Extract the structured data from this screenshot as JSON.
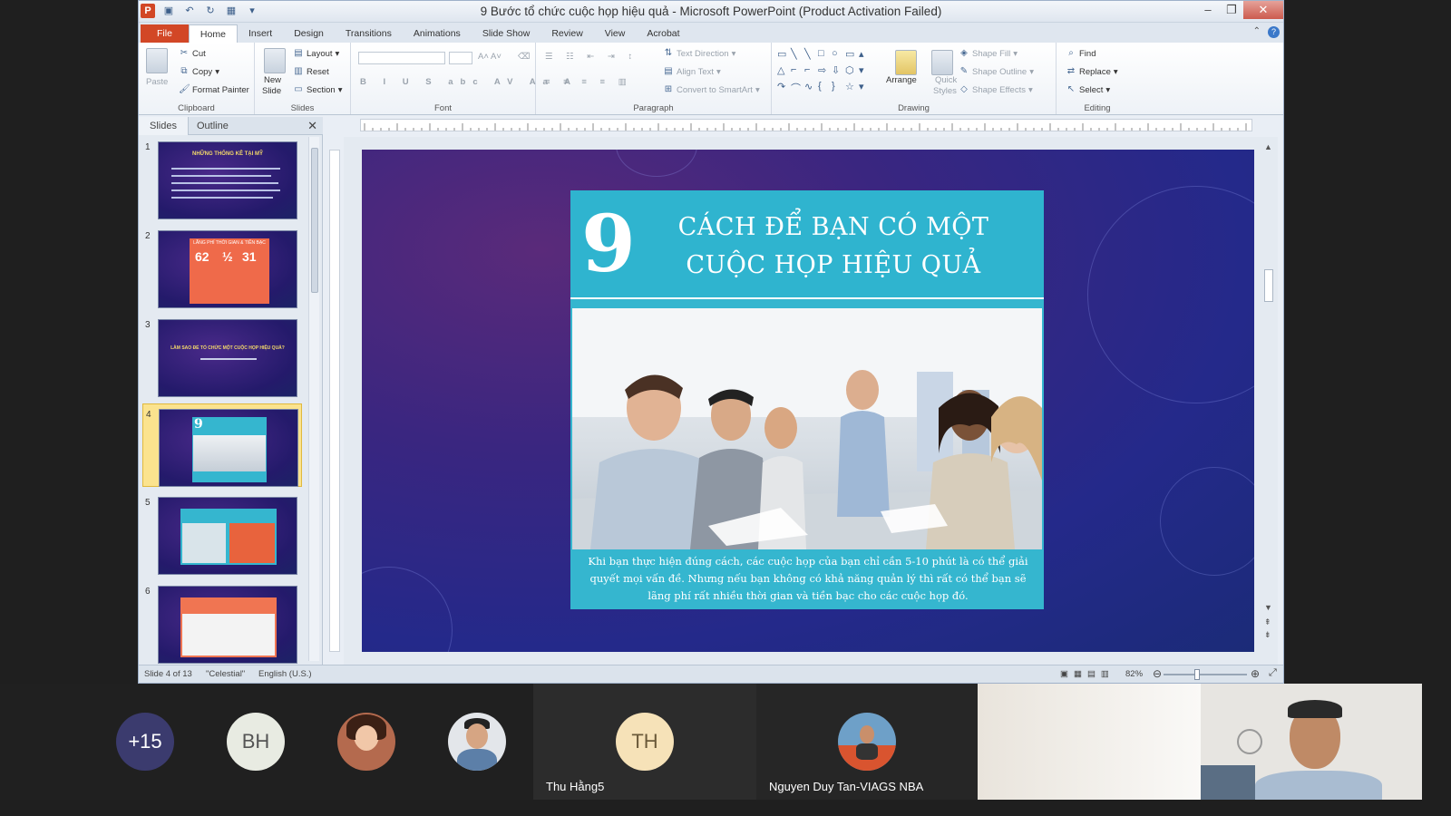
{
  "window": {
    "title": "9 Bước tổ chức cuộc họp hiệu quả - Microsoft PowerPoint (Product Activation Failed)",
    "app_logo": "P"
  },
  "ribbon_tabs": [
    "File",
    "Home",
    "Insert",
    "Design",
    "Transitions",
    "Animations",
    "Slide Show",
    "Review",
    "View",
    "Acrobat"
  ],
  "ribbon": {
    "clipboard": {
      "paste": "Paste",
      "cut": "Cut",
      "copy": "Copy",
      "format_painter": "Format Painter",
      "label": "Clipboard"
    },
    "slides": {
      "new_slide": "New",
      "new_slide2": "Slide",
      "layout": "Layout",
      "reset": "Reset",
      "section": "Section",
      "label": "Slides"
    },
    "font": {
      "label": "Font"
    },
    "paragraph": {
      "text_direction": "Text Direction",
      "align_text": "Align Text",
      "convert": "Convert to SmartArt",
      "label": "Paragraph"
    },
    "drawing": {
      "arrange": "Arrange",
      "quick_styles": "Quick",
      "quick_styles2": "Styles",
      "shape_fill": "Shape Fill",
      "shape_outline": "Shape Outline",
      "shape_effects": "Shape Effects",
      "label": "Drawing"
    },
    "editing": {
      "find": "Find",
      "replace": "Replace",
      "select": "Select",
      "label": "Editing"
    }
  },
  "pane": {
    "tab_slides": "Slides",
    "tab_outline": "Outline"
  },
  "thumbnails": [
    {
      "num": "1",
      "title": "NHỮNG THỐNG KÊ TẠI MỸ"
    },
    {
      "num": "2",
      "title": "LÃNG PHÍ THỜI GIAN & TIỀN BẠC",
      "v1": "62",
      "v2": "½",
      "v3": "31"
    },
    {
      "num": "3",
      "title": "LÀM SAO ĐỂ TỔ CHỨC MỘT CUỘC HỌP HIỆU QUẢ?"
    },
    {
      "num": "4",
      "title": "9"
    },
    {
      "num": "5",
      "title": ""
    },
    {
      "num": "6",
      "title": ""
    }
  ],
  "slide": {
    "number": "9",
    "title": "CÁCH ĐỂ BẠN CÓ MỘT CUỘC HỌP HIỆU QUẢ",
    "body": "Khi bạn thực hiện đúng cách, các cuộc họp của bạn chỉ cần 5-10 phút là có thể giải quyết mọi vấn đề. Nhưng nếu bạn không có khả năng quản lý thì rất có thể bạn sẽ lãng phí rất nhiều thời gian và tiền bạc cho các cuộc họp đó."
  },
  "status": {
    "slide_of": "Slide 4 of 13",
    "theme": "\"Celestial\"",
    "language": "English (U.S.)",
    "zoom": "82%"
  },
  "meeting": {
    "more_count": "+15",
    "initials_bh": "BH",
    "initials_th": "TH",
    "name_th": "Thu Hằng5",
    "name_nguyen": "Nguyen Duy Tan-VIAGS NBA"
  },
  "colors": {
    "accent_file": "#d24726",
    "slide_card": "#35b6cf",
    "slide_bg": "#2a2780"
  }
}
